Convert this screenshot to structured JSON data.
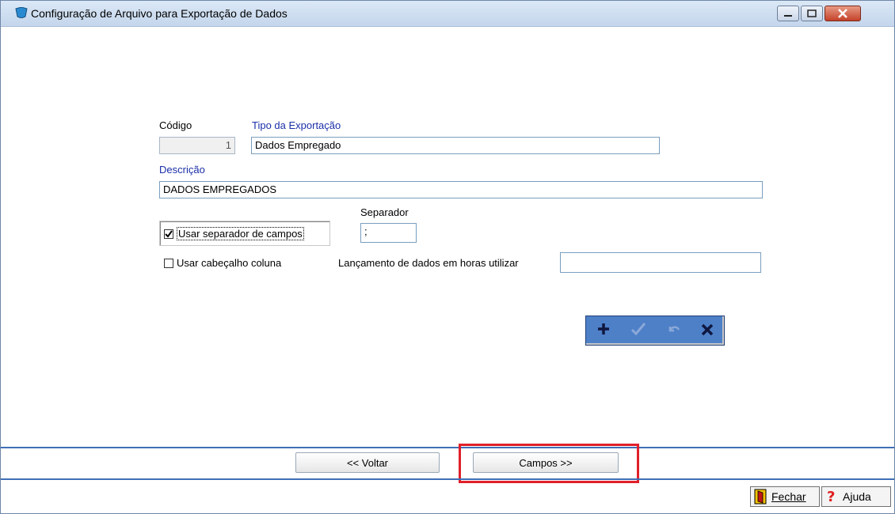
{
  "window": {
    "title": "Configuração de Arquivo para Exportação de Dados",
    "controls": {
      "minimize_icon": "minimize-icon",
      "maximize_icon": "maximize-icon",
      "close_icon": "close-icon"
    }
  },
  "form": {
    "codigo_label": "Código",
    "codigo_value": "1",
    "tipo_label": "Tipo da Exportação",
    "tipo_value": "Dados Empregado",
    "descricao_label": "Descrição",
    "descricao_value": "DADOS EMPREGADOS",
    "separador_label": "Separador",
    "separador_value": ";",
    "usar_separador_label": "Usar separador de campos",
    "usar_separador_checked": true,
    "usar_cabecalho_label": "Usar cabeçalho coluna",
    "usar_cabecalho_checked": false,
    "lancamento_label": "Lançamento de dados em horas utilizar",
    "lancamento_value": ""
  },
  "navigator": {
    "buttons": [
      "add",
      "confirm",
      "undo",
      "delete"
    ],
    "colors": {
      "add": "#101840",
      "confirm": "#8aa8d8",
      "undo": "#8aa8d8",
      "delete": "#101840"
    }
  },
  "footer": {
    "voltar_label": "<< Voltar",
    "campos_label": "Campos >>",
    "fechar_label": "Fechar",
    "ajuda_label": "Ajuda"
  },
  "colors": {
    "accent_line": "#3f6fb6",
    "highlight": "#e0202a",
    "label_blue": "#1b2fa8"
  }
}
